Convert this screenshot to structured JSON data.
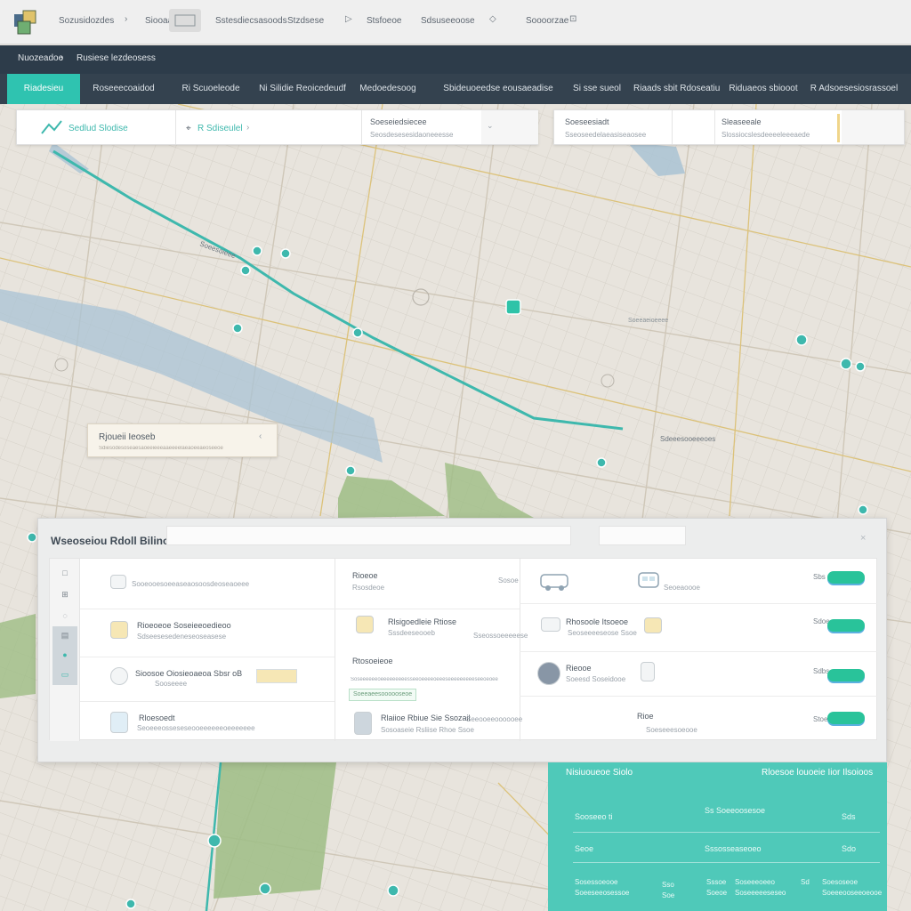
{
  "topbar": {
    "items": [
      "Sozusidozdes",
      "Siooaate",
      "Sstesdiecsasoods",
      "Stzdsese",
      "Stsfoeoe",
      "Sdsuseeoose",
      "Soooorzae"
    ],
    "glyphs": [
      "›",
      "▷",
      "◇",
      "⊡"
    ]
  },
  "subbar": {
    "breadcrumb": "Nuozeadoe",
    "title": "Rusiese lezdeosess"
  },
  "tabs": [
    {
      "label": "Riadesieu",
      "active": true
    },
    {
      "label": "Roseeecoaidod",
      "active": false
    },
    {
      "label": "Ri Scuoeleode",
      "active": false
    },
    {
      "label": "Ni Silidie Reoicedeudf",
      "active": false
    },
    {
      "label": "Medoedesoog",
      "active": false
    },
    {
      "label": "Sbideuoeedse eousaeadise",
      "active": false
    },
    {
      "label": "Si sse sueol",
      "active": false
    },
    {
      "label": "Riaads sbit Rdoseatiu",
      "active": false
    },
    {
      "label": "Riduaeos sbiooot",
      "active": false
    },
    {
      "label": "R Adsoesesiosrassoel",
      "active": false
    }
  ],
  "search_card_1": {
    "origin": "Sedlud Slodise",
    "destination": "R Sdiseulel",
    "field_label": "Soeseiedsiecee",
    "field_sub": "Seosdesesesidaoneeesse"
  },
  "search_card_2": {
    "field1_label": "Soeseesiadt",
    "field1_sub": "Sseoseedelaeasiseaosee",
    "field2_label": "Sleaseeale",
    "field2_sub": "Slossiocslesdeeeeleeeaede"
  },
  "callout": {
    "title": "Rjoueii Ieoseb",
    "sub": "Sdiesodesoseaesaoeeieeeaaeeeelaeaoeeaeoseeoe",
    "glyph": "‹"
  },
  "map_labels": {
    "l1": "Soeesoieee",
    "l2": "Sdeeesooeeeoes",
    "l3": "Soeeaeioeeee"
  },
  "results_panel": {
    "title": "Wseoseiou Rdoll Bilinouol",
    "close_glyph": "×",
    "rail": [
      "□",
      "⊞",
      "◌",
      "▤",
      "●",
      "▭"
    ],
    "left_rows": [
      {
        "title": "Sooeooesoeeaseaosoosdeoseaoeee",
        "sub": ""
      },
      {
        "title": "Rioeoeoe Soseieeoedieoo",
        "sub": "Sdseesesedeneseoseasese"
      },
      {
        "title": "Sioosoe Oiosieoaeoa Sbsr oB",
        "sub": "Sooseeee"
      },
      {
        "title": "Rloesoedt",
        "sub": "Seoeeeosseseseooeeeeeeoeeeeeee"
      }
    ],
    "middle_rows": [
      {
        "title": "Rioeoe",
        "sub": "Rsosdeoe",
        "meta": "Sosoe"
      },
      {
        "title": "Rlsigoedleie Rtiose",
        "sub": "Sssdeeseooeb",
        "meta": "Sseossoeeeeese"
      },
      {
        "title": "Rtosoeieoe",
        "sub": "Soseeeeeeoeeeeeeeeesseeoeeeeoeeeseeeeeeeeeseeoeoee",
        "tag": "Soeeaeesoooooseoe"
      },
      {
        "title": "Rlaiioe Rbiue Sie Ssozail",
        "sub": "Sosoaseie Rsliise Rhoe Ssoe",
        "meta": "Seeooeeoooooee"
      }
    ],
    "right_rows": [
      {
        "title": "",
        "sub": "",
        "extra": "Seoeaoooe",
        "num": "Sbs"
      },
      {
        "title": "Rhosoole Itsoeoe",
        "sub": "Seoseeeeseose Ssoe",
        "num": "Sdoe"
      },
      {
        "title": "Rieooe",
        "sub": "Soeesd Soseidooe",
        "num": "Sdbs"
      },
      {
        "title": "Rioe",
        "sub": "Soeseeesoeooe",
        "num": "Stoe"
      }
    ]
  },
  "stats_panel": {
    "header_left": "Nisiuoueoe Siolo",
    "header_right": "Rloesoe louoeie Iior Ilsoioos",
    "rows": [
      {
        "label": "Sooseeo ti",
        "value": "Ss Soeeoosesoe",
        "num": "Sds"
      },
      {
        "label": "Seoe",
        "value": "Sssosseaseoeo",
        "num": "Sdo"
      }
    ],
    "footer": [
      {
        "label": "Sosessoeooe",
        "value": "Soeeseeosessoe"
      },
      {
        "label": "Sso",
        "value": "Soe"
      },
      {
        "label": "Sssoe",
        "value": "Soeoe"
      },
      {
        "label": "Soseeeoeeo",
        "value": "Soseeeeeseseo"
      },
      {
        "label": "Sd",
        "value": ""
      },
      {
        "label": "Soesoseoe",
        "value": "Soeeeooseeoeooe"
      }
    ]
  },
  "colors": {
    "accent": "#2fc3b0",
    "route": "#3eb8ad",
    "dark_bar": "#2d3c4a",
    "water": "#a9c3d4",
    "park": "#9dbd85"
  }
}
